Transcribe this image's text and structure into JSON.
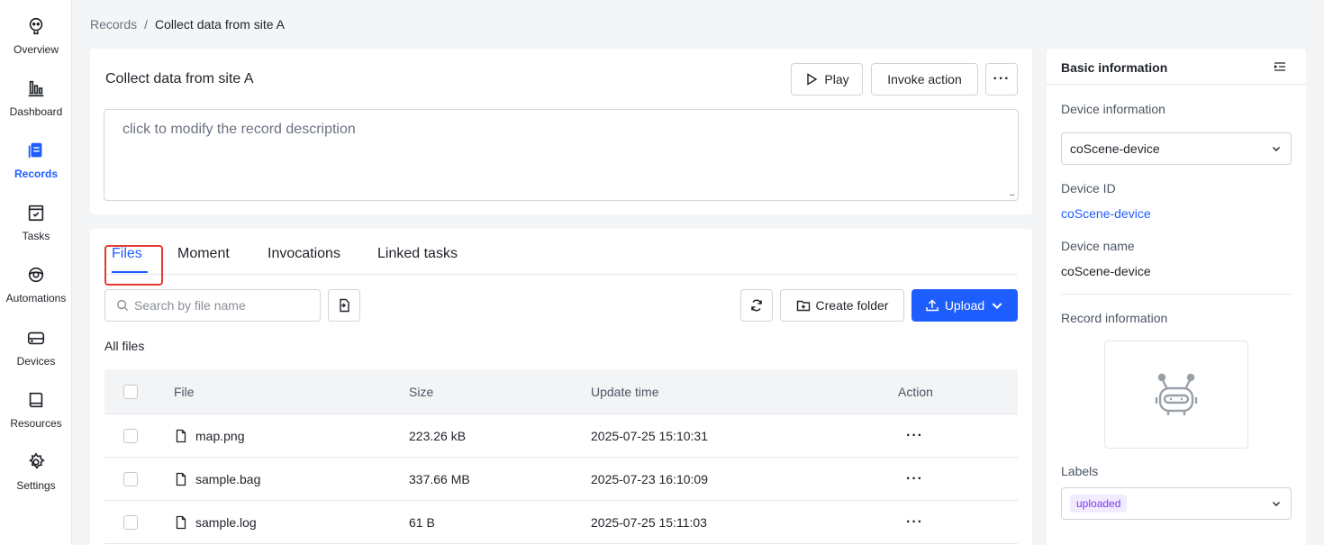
{
  "nav": [
    {
      "label": "Overview",
      "icon": "overview-icon"
    },
    {
      "label": "Dashboard",
      "icon": "dashboard-icon"
    },
    {
      "label": "Records",
      "icon": "records-icon",
      "active": true
    },
    {
      "label": "Tasks",
      "icon": "tasks-icon"
    },
    {
      "label": "Automations",
      "icon": "automations-icon"
    },
    {
      "label": "Devices",
      "icon": "devices-icon"
    },
    {
      "label": "Resources",
      "icon": "resources-icon"
    },
    {
      "label": "Settings",
      "icon": "settings-icon"
    }
  ],
  "breadcrumb": {
    "root": "Records",
    "separator": "/",
    "current": "Collect data from site A"
  },
  "record": {
    "title": "Collect data from site A",
    "play_label": "Play",
    "invoke_label": "Invoke action",
    "more_label": "···",
    "description_placeholder": "click to modify the record description",
    "resize_hint": "..."
  },
  "tabs": [
    {
      "label": "Files",
      "active": true
    },
    {
      "label": "Moment"
    },
    {
      "label": "Invocations"
    },
    {
      "label": "Linked tasks"
    }
  ],
  "files": {
    "search_placeholder": "Search by file name",
    "create_folder_label": "Create folder",
    "upload_label": "Upload",
    "all_files_label": "All files",
    "columns": {
      "file": "File",
      "size": "Size",
      "update_time": "Update time",
      "action": "Action"
    },
    "action_dots": "···",
    "rows": [
      {
        "name": "map.png",
        "size": "223.26 kB",
        "updated": "2025-07-25 15:10:31"
      },
      {
        "name": "sample.bag",
        "size": "337.66 MB",
        "updated": "2025-07-23 16:10:09"
      },
      {
        "name": "sample.log",
        "size": "61 B",
        "updated": "2025-07-25 15:11:03"
      }
    ]
  },
  "panel": {
    "title": "Basic information",
    "device_info_label": "Device information",
    "device_select_value": "coScene-device",
    "device_id_label": "Device ID",
    "device_id_value": "coScene-device",
    "device_name_label": "Device name",
    "device_name_value": "coScene-device",
    "record_info_label": "Record information",
    "labels_label": "Labels",
    "label_tag": "uploaded"
  },
  "colors": {
    "accent": "#1e5eff",
    "highlight": "#e53935",
    "tag_bg": "#f1ebff",
    "tag_text": "#7c3aed"
  }
}
